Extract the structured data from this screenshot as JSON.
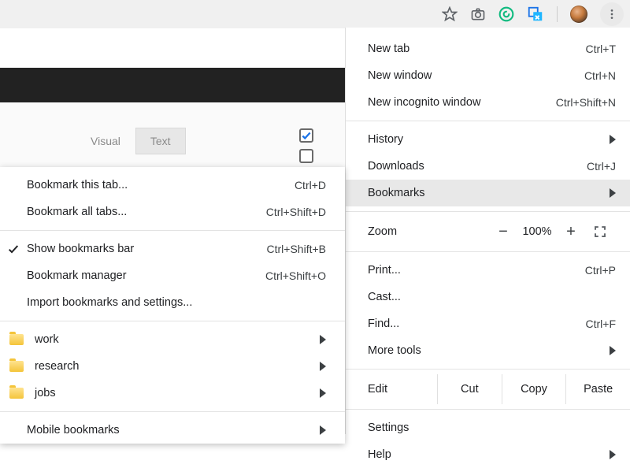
{
  "toolbar": {
    "icons": [
      "star",
      "camera",
      "grammarly",
      "translate",
      "avatar",
      "kebab"
    ]
  },
  "editor": {
    "tabs": {
      "visual": "Visual",
      "text": "Text"
    }
  },
  "main_menu": {
    "new_tab": {
      "label": "New tab",
      "shortcut": "Ctrl+T"
    },
    "new_window": {
      "label": "New window",
      "shortcut": "Ctrl+N"
    },
    "incognito": {
      "label": "New incognito window",
      "shortcut": "Ctrl+Shift+N"
    },
    "history": {
      "label": "History"
    },
    "downloads": {
      "label": "Downloads",
      "shortcut": "Ctrl+J"
    },
    "bookmarks": {
      "label": "Bookmarks"
    },
    "zoom": {
      "label": "Zoom",
      "minus": "−",
      "pct": "100%",
      "plus": "+"
    },
    "print": {
      "label": "Print...",
      "shortcut": "Ctrl+P"
    },
    "cast": {
      "label": "Cast..."
    },
    "find": {
      "label": "Find...",
      "shortcut": "Ctrl+F"
    },
    "more_tools": {
      "label": "More tools"
    },
    "edit": {
      "label": "Edit",
      "cut": "Cut",
      "copy": "Copy",
      "paste": "Paste"
    },
    "settings": {
      "label": "Settings"
    },
    "help": {
      "label": "Help"
    }
  },
  "bookmarks_menu": {
    "bookmark_tab": {
      "label": "Bookmark this tab...",
      "shortcut": "Ctrl+D"
    },
    "bookmark_all": {
      "label": "Bookmark all tabs...",
      "shortcut": "Ctrl+Shift+D"
    },
    "show_bar": {
      "label": "Show bookmarks bar",
      "shortcut": "Ctrl+Shift+B",
      "checked": true
    },
    "manager": {
      "label": "Bookmark manager",
      "shortcut": "Ctrl+Shift+O"
    },
    "import": {
      "label": "Import bookmarks and settings..."
    },
    "folders": [
      {
        "label": "work"
      },
      {
        "label": "research"
      },
      {
        "label": "jobs"
      }
    ],
    "mobile": {
      "label": "Mobile bookmarks"
    }
  }
}
